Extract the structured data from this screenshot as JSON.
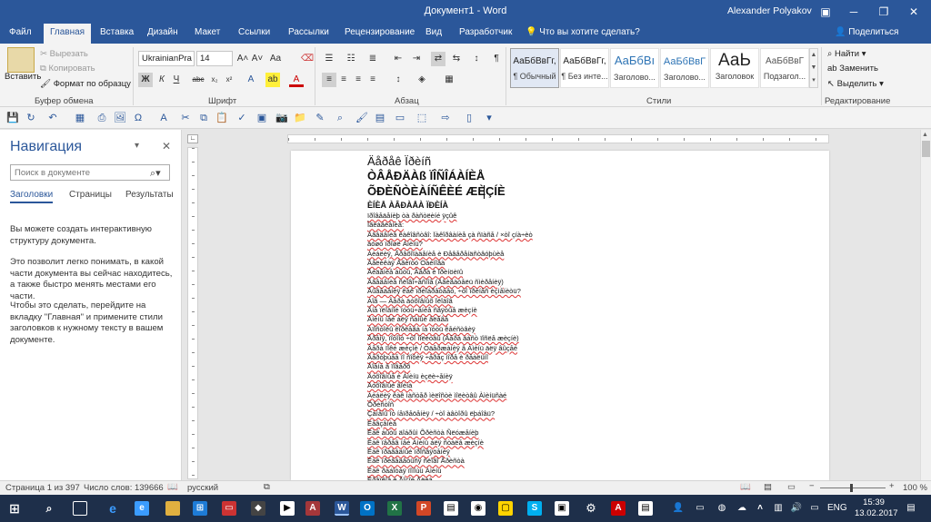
{
  "window": {
    "title": "Документ1 - Word",
    "user": "Alexander Polyakov"
  },
  "tabs": [
    "Файл",
    "Главная",
    "Вставка",
    "Дизайн",
    "Макет",
    "Ссылки",
    "Рассылки",
    "Рецензирование",
    "Вид",
    "Разработчик"
  ],
  "tell_me": "Что вы хотите сделать?",
  "share": "Поделиться",
  "clipboard": {
    "paste": "Вставить",
    "cut": "Вырезать",
    "copy": "Копировать",
    "format_painter": "Формат по образцу",
    "group": "Буфер обмена"
  },
  "font": {
    "name": "UkrainianPra",
    "size": "14",
    "group": "Шрифт"
  },
  "paragraph": {
    "group": "Абзац"
  },
  "styles": {
    "group": "Стили",
    "tiles": [
      {
        "preview": "АаБбВвГг,",
        "name": "¶ Обычный"
      },
      {
        "preview": "АаБбВвГг,",
        "name": "¶ Без инте..."
      },
      {
        "preview": "АаБбВı",
        "name": "Заголово..."
      },
      {
        "preview": "АаБбВвГ",
        "name": "Заголово..."
      },
      {
        "preview": "АаЬ",
        "name": "Заголовок"
      },
      {
        "preview": "АаБбВвГ",
        "name": "Подзагол..."
      }
    ]
  },
  "editing": {
    "find": "Найти",
    "replace": "Заменить",
    "select": "Выделить",
    "group": "Редактирование"
  },
  "nav": {
    "title": "Навигация",
    "search_placeholder": "Поиск в документе",
    "tabs": [
      "Заголовки",
      "Страницы",
      "Результаты"
    ],
    "para1": "Вы можете создать интерактивную структуру документа.",
    "para2": "Это позволит легко понимать, в какой части документа вы сейчас находитесь, а также быстро менять местами его части.",
    "para3": "Чтобы это сделать, перейдите на вкладку \"Главная\" и примените стили заголовков к нужному тексту в вашем документе."
  },
  "document": {
    "heading1": "Äåðåê Ïðèíñ",
    "heading2": "ÒÂÅÐÄÀß ÏÎÑÎÁÀÍÈÅ",
    "heading3": "ÕÐÈÑÒÈÀÍÑÊÈÉ ÆÈÇÍÈ",
    "subheading": "ÈÍÈÅ ÀÂÐÀÅÀ ÏÐÈÍÀ",
    "lines": [
      "ïðîâåäåíèþ òà ðàñòëèíé ÿçûê",
      "Îãëàâëåíèå:",
      "Ââåäåíèå êàêîâñòâî: Ïàêîðâàíèå çà ñïàñå / ×òî çíà÷èò",
      "äóøó ïðîøë Àìèíü?",
      "Áèáëèÿ, Ãðåõîïàäåíèå è Ðåâåðåíäñòâóþùèå",
      "Âåëèêàÿ Åãèïòó Òàéíîâà",
      "Âèäåíèå áûòü, Âåðà è Ïðèíöèïû",
      "Ââåäåíèå ñëîâî÷åñíîå (Äâèãàòåëü ñìèðåíèÿ)",
      "Âûâåäåíèÿ êàê ïðèîáðåòàåò, ÷òî ïðèíåñ èçìåíèòü?",
      "Áîã — Âåðà äóõîâíûõ Ïëîäîâ",
      "Ãíå ïëîäíîé ïóòü÷åíèå ñâÿòûå æèçíè",
      "Àìèíü íåé áëÿ ñàìûé âëåâå",
      "Àïîñòîëû êîðëåãà íà ïóòü êåéñòâèÿ",
      "Âðåìÿ, ïîòîìó ÷òî ìîëèòâû (Âåðà äàñò ïîñëå æèçíè)",
      "Âåðà ïîêé æèçíè / Óäåðæàíèÿ â Àìèíü äëÿ âûçåé",
      "Âåðóþùåå ïî ñîôèÿ ÷åðåç ìîðå è ðåàëüíî",
      "Âîåíà â ïîâåðõ",
      "Äóõîâíûå è Àìèíü èçëè÷åíèÿ",
      "Äóõîâíûé âîéíà",
      "Áèáëèÿ êàê ìàñòåð ìèëîñòè ìîëèòâû Àìèíüñàé",
      "Õðèñòîñ",
      "Çàìåíû îò íåïðåöåíèÿ / ÷òî àâòîðû ëþáîâü?",
      "Ëåâçåíèå",
      "Êàê áûòü äîáðûì Õðèñòà Ñëóæåíèþ",
      "Êàê ïåðåâ íåé Àìèíü áëÿ ñòàëå æèçíè",
      "Êàê ïðàâåäíûé ïðîñâÿöåíèÿ",
      "Êàê ïðèâåäåòüñÿ ñëîâî Ãðèñòà",
      "Êàê ðàáîòàÿ ïîìîùü Àìèíü",
      "Êðåïêîå è Ãîçîé Åëèà"
    ]
  },
  "status": {
    "page": "Страница 1 из 397",
    "words": "Число слов: 139666",
    "lang": "русский",
    "zoom": "100 %"
  },
  "taskbar": {
    "lang": "ENG",
    "time": "15:39",
    "date": "13.02.2017"
  },
  "colors": {
    "brand": "#2b579a",
    "taskbar": "#1e2f4a"
  }
}
